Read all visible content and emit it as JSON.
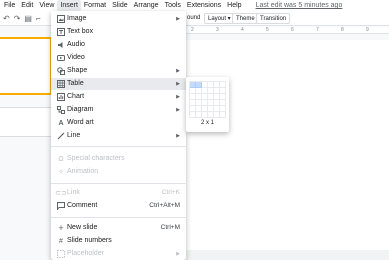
{
  "menubar": {
    "items": [
      "File",
      "Edit",
      "View",
      "Insert",
      "Format",
      "Slide",
      "Arrange",
      "Tools",
      "Extensions",
      "Help"
    ],
    "active": "Insert",
    "last_edit": "Last edit was 5 minutes ago"
  },
  "toolbar": {
    "background_label": "ound",
    "layout_label": "Layout ▾",
    "theme_label": "Theme",
    "transition_label": "Transition"
  },
  "ruler": {
    "ticks": [
      "2",
      "3",
      "4",
      "5",
      "6",
      "7",
      "8",
      "9"
    ]
  },
  "insert_menu": {
    "items": [
      {
        "icon": "image-icon",
        "label": "Image",
        "submenu": true
      },
      {
        "icon": "text-box-icon",
        "label": "Text box"
      },
      {
        "icon": "audio-icon",
        "label": "Audio"
      },
      {
        "icon": "video-icon",
        "label": "Video"
      },
      {
        "icon": "shape-icon",
        "label": "Shape",
        "submenu": true
      },
      {
        "icon": "table-icon",
        "label": "Table",
        "submenu": true,
        "highlighted": true
      },
      {
        "icon": "chart-icon",
        "label": "Chart",
        "submenu": true
      },
      {
        "icon": "diagram-icon",
        "label": "Diagram",
        "submenu": true
      },
      {
        "icon": "word-art-icon",
        "label": "Word art"
      },
      {
        "icon": "line-icon",
        "label": "Line",
        "submenu": true
      },
      {
        "icon": "special-characters-icon",
        "label": "Special characters",
        "disabled": true
      },
      {
        "icon": "animation-icon",
        "label": "Animation",
        "disabled": true
      },
      {
        "icon": "link-icon",
        "label": "Link",
        "shortcut": "Ctrl+K",
        "disabled": true
      },
      {
        "icon": "comment-icon",
        "label": "Comment",
        "shortcut": "Ctrl+Alt+M"
      },
      {
        "icon": "new-slide-icon",
        "label": "New slide",
        "shortcut": "Ctrl+M"
      },
      {
        "icon": "slide-numbers-icon",
        "label": "Slide numbers"
      },
      {
        "icon": "placeholder-icon",
        "label": "Placeholder",
        "submenu": true,
        "disabled": true
      }
    ]
  },
  "table_submenu": {
    "size_label": "2 x 1",
    "selected_cols": 2,
    "selected_rows": 1
  },
  "colors": {
    "highlight": "#e8eaed",
    "selected_cell": "#c6dafc",
    "thumb_border": "#f9ab00"
  }
}
